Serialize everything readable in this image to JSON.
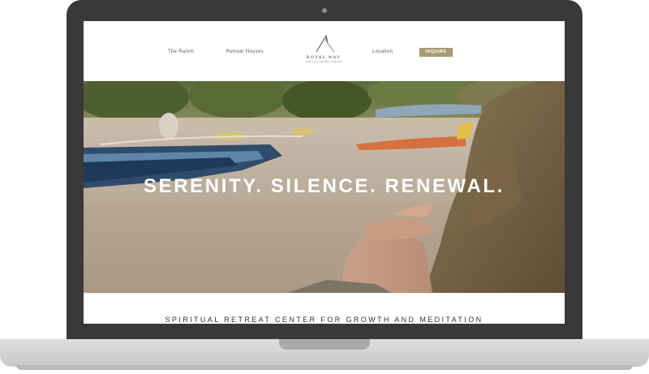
{
  "nav": {
    "left_links": [
      "The Ranch",
      "Retreat Houses"
    ],
    "right_links": [
      "Location"
    ],
    "inquire_label": "INQUIRE"
  },
  "logo": {
    "name": "ROYAL WAY",
    "tagline": "SPIRITUAL RETREAT CENTER"
  },
  "hero": {
    "headline": "SERENITY. SILENCE. RENEWAL."
  },
  "tagline": "SPIRITUAL RETREAT CENTER FOR GROWTH AND MEDITATION",
  "colors": {
    "accent": "#a89a72",
    "bezel": "#3a3839",
    "hero_text": "#ffffff"
  }
}
